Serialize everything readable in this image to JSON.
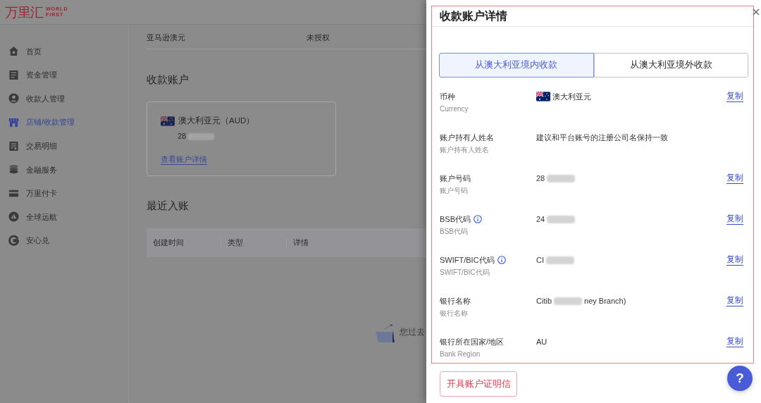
{
  "header": {
    "logo": {
      "chinese": "万里汇",
      "english": [
        "WORLD",
        "FIRST"
      ]
    }
  },
  "sidebar": {
    "items": [
      {
        "label": "首页",
        "selected": false
      },
      {
        "label": "资金管理",
        "selected": false
      },
      {
        "label": "收款人管理",
        "selected": false
      },
      {
        "label": "店铺/收款管理",
        "selected": true
      },
      {
        "label": "交易明细",
        "selected": false
      },
      {
        "label": "金融服务",
        "selected": false
      },
      {
        "label": "万里付卡",
        "selected": false
      },
      {
        "label": "全球远航",
        "selected": false
      },
      {
        "label": "安心兑",
        "selected": false
      }
    ]
  },
  "main": {
    "store_row": {
      "name": "亚马逊澳元",
      "status": "未授权"
    },
    "accounts_heading": "收款账户",
    "account_card": {
      "currency": "澳大利亚元（AUD）",
      "number": [
        {
          "kind": "text",
          "text": "28"
        },
        {
          "kind": "blur"
        }
      ],
      "link": "查看账户详情"
    },
    "recent_heading": "最近入账",
    "table": {
      "columns": [
        "创建时间",
        "类型",
        "详情"
      ]
    },
    "empty_text": "您过去"
  },
  "drawer": {
    "title": "收款账户详情",
    "highlighted": true,
    "tabs": [
      {
        "label": "从澳大利亚境内收款",
        "selected": true
      },
      {
        "label": "从澳大利亚境外收款",
        "selected": false
      }
    ],
    "fields": [
      {
        "label": "币种",
        "info": false,
        "sublabel": "Currency",
        "value": [
          {
            "kind": "flag"
          },
          {
            "kind": "text",
            "text": "澳大利亚元"
          }
        ],
        "copy": "复制"
      },
      {
        "label": "账户持有人姓名",
        "info": false,
        "sublabel": "账户持有人姓名",
        "value": [
          {
            "kind": "text",
            "text": "建议和平台账号的注册公司名保持一致"
          }
        ]
      },
      {
        "label": "账户号码",
        "info": false,
        "sublabel": "账户号码",
        "value": [
          {
            "kind": "text",
            "text": "28"
          },
          {
            "kind": "blur"
          }
        ],
        "copy": "复制"
      },
      {
        "label": "BSB代码",
        "info": true,
        "sublabel": "BSB代码",
        "value": [
          {
            "kind": "text",
            "text": "24"
          },
          {
            "kind": "blur"
          }
        ],
        "copy": "复制"
      },
      {
        "label": "SWIFT/BIC代码",
        "info": true,
        "sublabel": "SWIFT/BIC代码",
        "value": [
          {
            "kind": "text",
            "text": "CI"
          },
          {
            "kind": "blur"
          }
        ],
        "copy": "复制"
      },
      {
        "label": "银行名称",
        "info": false,
        "sublabel": "银行名称",
        "value": [
          {
            "kind": "text",
            "text": "Citib"
          },
          {
            "kind": "blur"
          },
          {
            "kind": "text",
            "text": "ney Branch)"
          }
        ],
        "copy": "复制"
      },
      {
        "label": "银行所在国家/地区",
        "info": false,
        "sublabel": "Bank Region",
        "value": [
          {
            "kind": "text",
            "text": "AU"
          }
        ],
        "copy": "复制"
      }
    ],
    "certificate_button": "开具账户证明信",
    "help_button": "?"
  }
}
